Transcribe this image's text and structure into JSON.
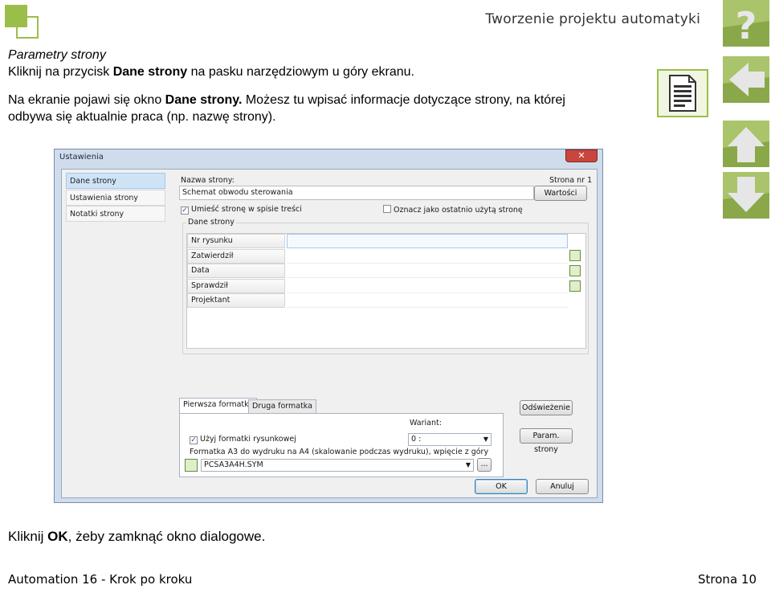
{
  "header": {
    "title": "Tworzenie projektu automatyki"
  },
  "intro": {
    "heading": "Parametry strony",
    "line1_pre": "Kliknij na przycisk ",
    "line1_bold": "Dane strony",
    "line1_post": " na pasku narzędziowym u góry ekranu.",
    "line2_pre": "Na ekranie pojawi się okno ",
    "line2_bold": "Dane strony.",
    "line2_post": " Możesz tu wpisać informacje dotyczące strony, na której",
    "line3": "odbywa się aktualnie praca (np. nazwę strony)."
  },
  "dialog": {
    "title": "Ustawienia",
    "close_glyph": "✕",
    "nav_items": [
      "Dane strony",
      "Ustawienia strony",
      "Notatki strony"
    ],
    "page_name_label": "Nazwa strony:",
    "page_number": "Strona nr 1",
    "page_name_value": "Schemat obwodu sterowania",
    "values_button": "Wartości",
    "check_toc_label": "Umieść stronę w spisie treści",
    "check_toc_checked": true,
    "check_last_used_label": "Oznacz jako ostatnio użytą stronę",
    "check_last_used_checked": false,
    "group_label": "Dane strony",
    "rows": [
      "Nr rysunku",
      "Zatwierdził",
      "Data",
      "Sprawdził",
      "Projektant"
    ],
    "tabs": [
      "Pierwsza formatka",
      "Druga formatka"
    ],
    "variant_label": "Wariant:",
    "variant_value": "0 :",
    "use_formats_label": "Użyj formatki rysunkowej",
    "use_formats_checked": true,
    "format_desc": "Formatka A3 do wydruku na A4 (skalowanie podczas wydruku), wpięcie z góry",
    "format_file": "PCSA3A4H.SYM",
    "browse_button": "...",
    "refresh_button": "Odświeżenie",
    "page_params_button": "Param. strony",
    "ok_button": "OK",
    "cancel_button": "Anuluj"
  },
  "bottom": {
    "pre": "Kliknij ",
    "bold": "OK",
    "post": ", żeby zamknąć okno dialogowe."
  },
  "footer": {
    "left": "Automation 16 - Krok po kroku",
    "right": "Strona 10"
  },
  "icons": {
    "help": "question-mark-icon",
    "back": "arrow-left-icon",
    "up": "arrow-up-icon",
    "down": "arrow-down-icon",
    "page_data": "document-icon"
  },
  "colors": {
    "accent_green": "#8aa84a",
    "dialog_frame": "#cfdcec"
  }
}
